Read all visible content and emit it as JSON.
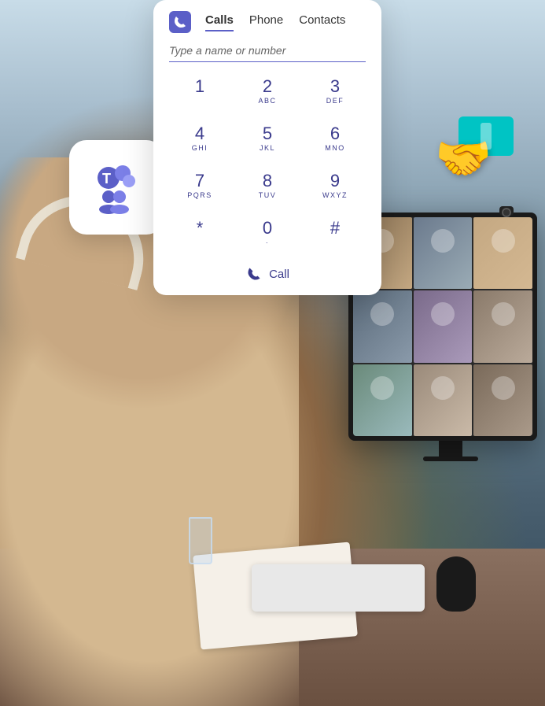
{
  "background": {
    "alt": "Woman with headphones at desk looking at monitor with video call"
  },
  "teams_logo": {
    "alt": "Microsoft Teams logo",
    "icon": "T"
  },
  "dialpad": {
    "phone_icon": "📞",
    "tabs": [
      {
        "label": "Calls",
        "active": true
      },
      {
        "label": "Phone",
        "active": false
      },
      {
        "label": "Contacts",
        "active": false
      }
    ],
    "input_placeholder": "Type a name or number",
    "keys": [
      {
        "number": "1",
        "letters": ""
      },
      {
        "number": "2",
        "letters": "ABC"
      },
      {
        "number": "3",
        "letters": "DEF"
      },
      {
        "number": "4",
        "letters": "GHI"
      },
      {
        "number": "5",
        "letters": "JKL"
      },
      {
        "number": "6",
        "letters": "MNO"
      },
      {
        "number": "7",
        "letters": "PQRS"
      },
      {
        "number": "8",
        "letters": "TUV"
      },
      {
        "number": "9",
        "letters": "WXYZ"
      },
      {
        "number": "*",
        "letters": ""
      },
      {
        "number": "0",
        "letters": "·"
      },
      {
        "number": "#",
        "letters": ""
      }
    ],
    "call_button_label": "Call"
  },
  "emoji": {
    "icon": "🤝",
    "alt": "Handshake emoji"
  },
  "monitor": {
    "alt": "Monitor showing video conference call with multiple participants",
    "video_tiles": 9
  },
  "desk": {
    "items": [
      "papers",
      "keyboard",
      "mouse",
      "water glass"
    ]
  }
}
